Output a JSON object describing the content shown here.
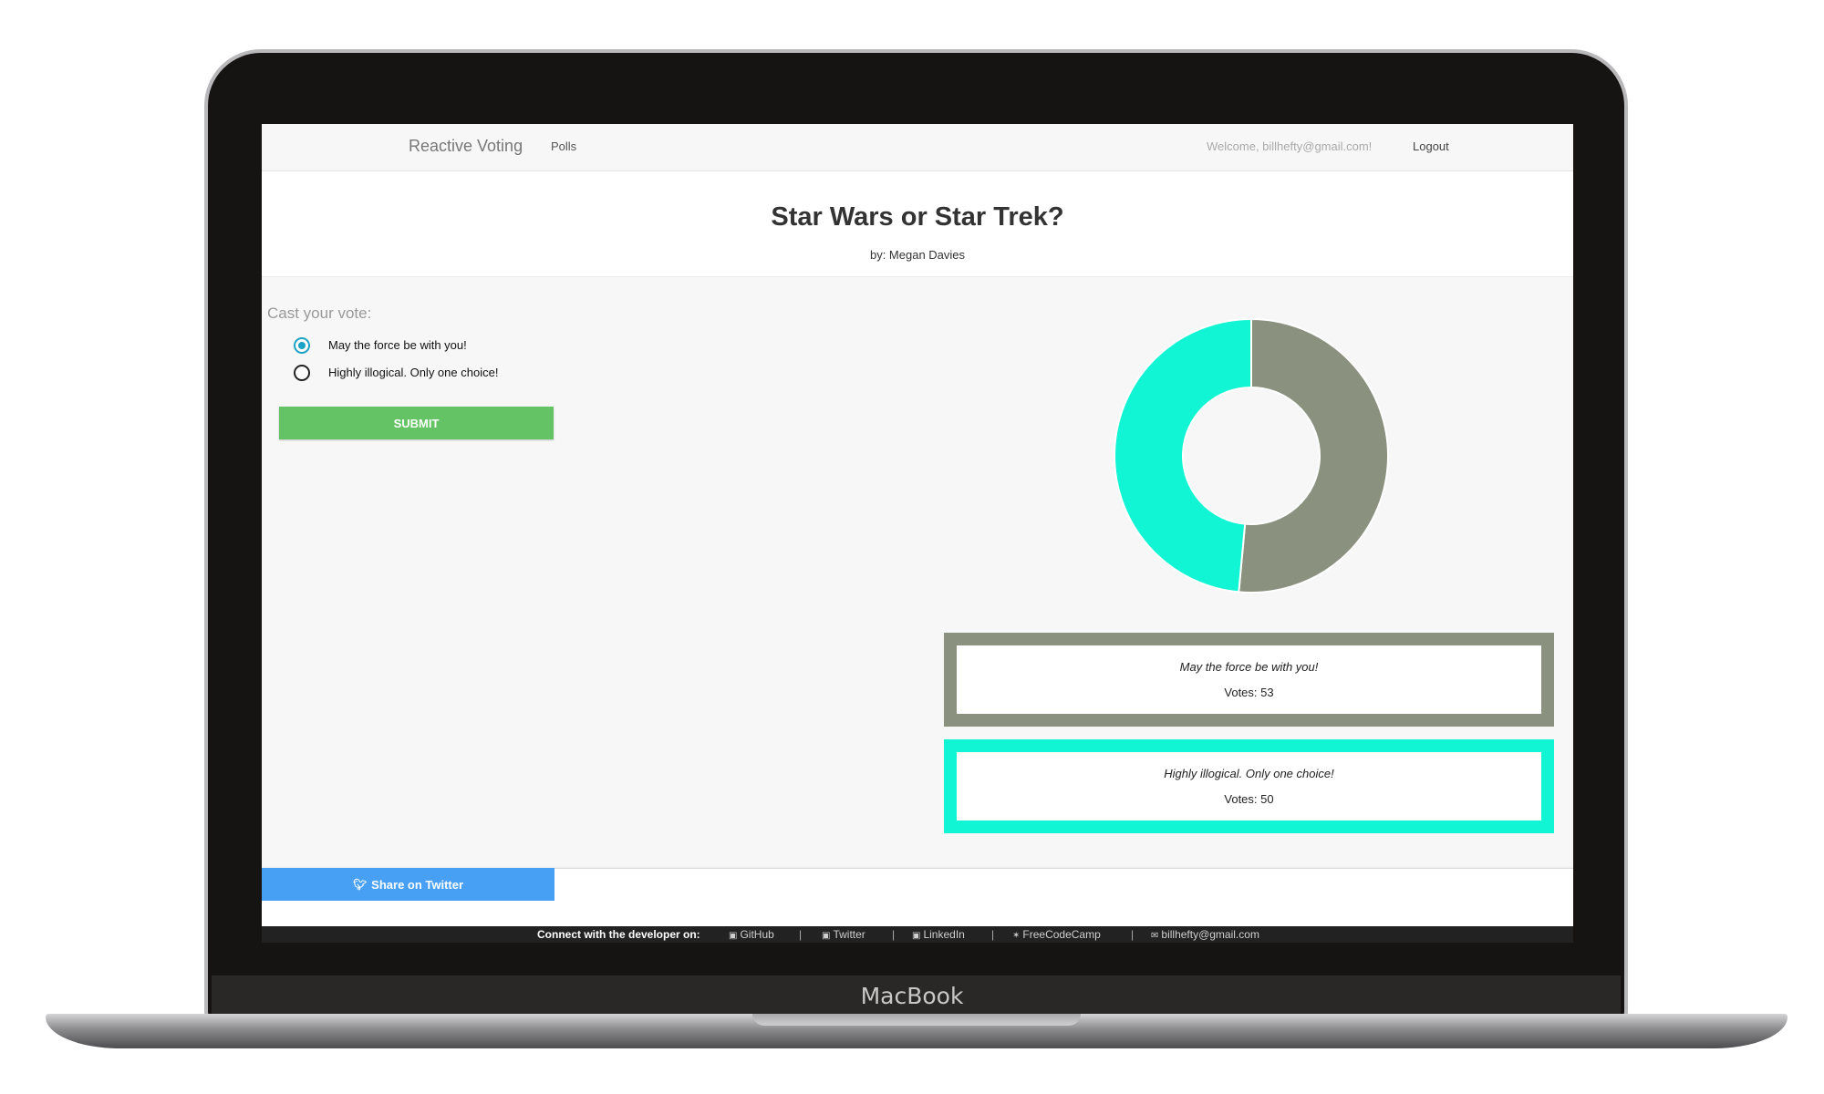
{
  "device": {
    "label": "MacBook"
  },
  "navbar": {
    "brand": "Reactive Voting",
    "polls_link": "Polls",
    "welcome": "Welcome, billhefty@gmail.com!",
    "logout": "Logout"
  },
  "poll": {
    "title": "Star Wars or Star Trek?",
    "author": "by: Megan Davies"
  },
  "vote_form": {
    "heading": "Cast your vote:",
    "options": [
      {
        "label": "May the force be with you!",
        "selected": true
      },
      {
        "label": "Highly illogical. Only one choice!",
        "selected": false
      }
    ],
    "submit_label": "SUBMIT"
  },
  "results": [
    {
      "option": "May the force be with you!",
      "votes_text": "Votes: 53",
      "color": "#8a917e"
    },
    {
      "option": "Highly illogical. Only one choice!",
      "votes_text": "Votes: 50",
      "color": "#12f5d4"
    }
  ],
  "chart_data": {
    "type": "pie",
    "categories": [
      "May the force be with you!",
      "Highly illogical. Only one choice!"
    ],
    "values": [
      53,
      50
    ],
    "colors": [
      "#8a917e",
      "#12f5d4"
    ],
    "donut": true
  },
  "share": {
    "label": "Share on Twitter",
    "icon": "twitter-icon"
  },
  "footer": {
    "connect_label": "Connect with the developer on:",
    "links": [
      {
        "label": "GitHub",
        "icon": "github-icon",
        "glyph": "▣"
      },
      {
        "label": "Twitter",
        "icon": "twitter-icon",
        "glyph": "▣"
      },
      {
        "label": "LinkedIn",
        "icon": "linkedin-icon",
        "glyph": "▣"
      },
      {
        "label": "FreeCodeCamp",
        "icon": "fire-icon",
        "glyph": "✶"
      },
      {
        "label": "billhefty@gmail.com",
        "icon": "envelope-icon",
        "glyph": "✉"
      }
    ],
    "separator": "|"
  }
}
